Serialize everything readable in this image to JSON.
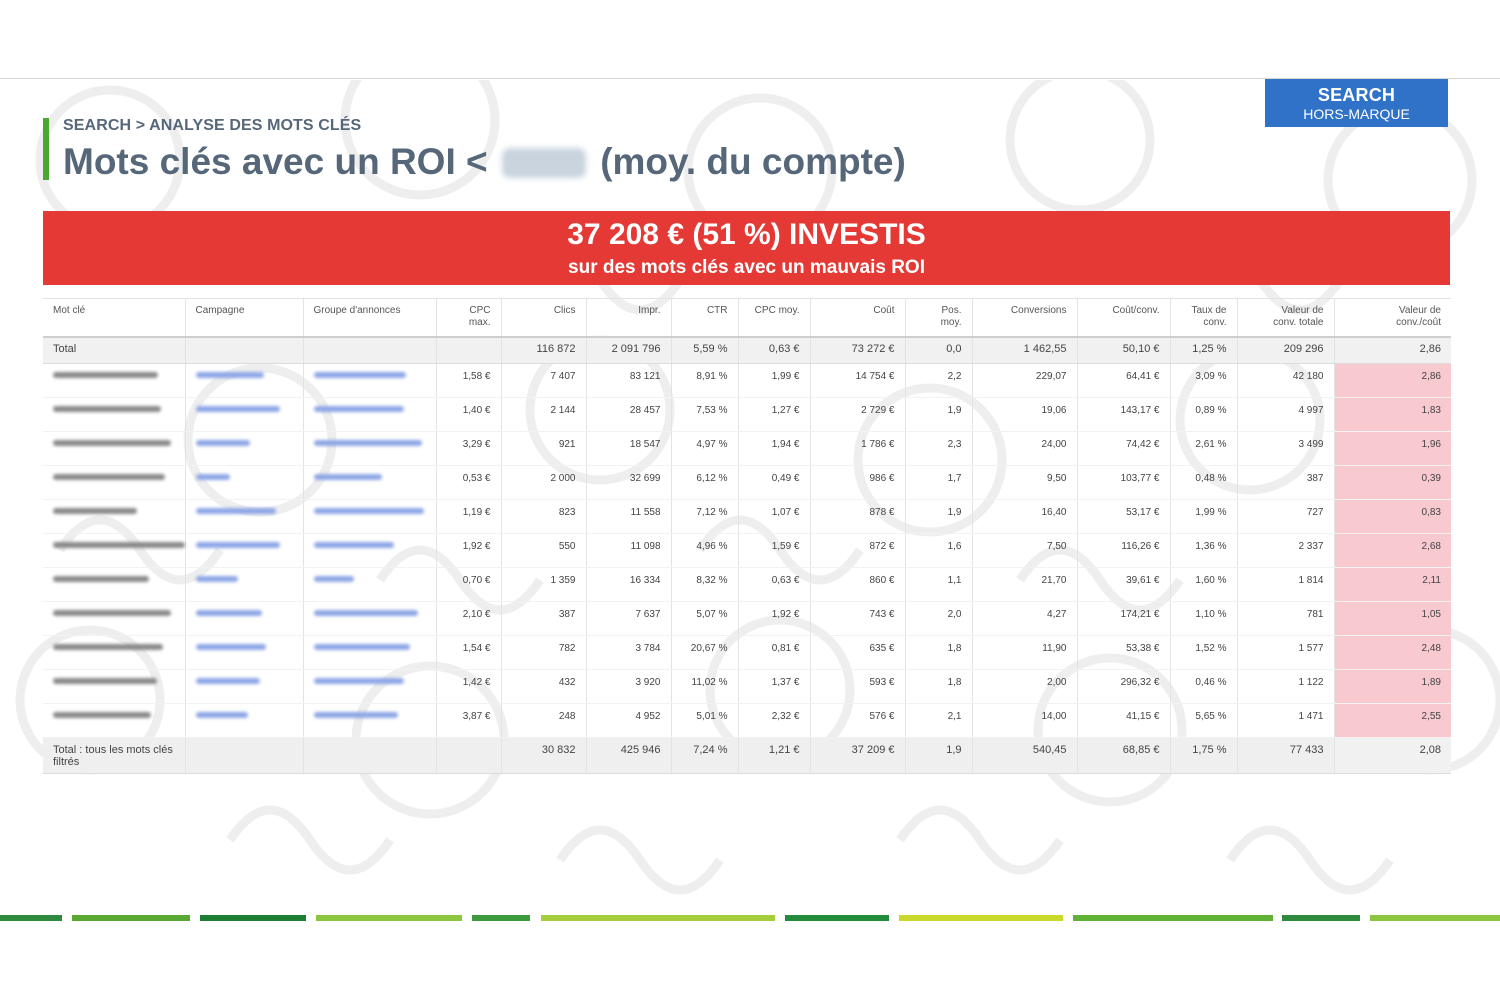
{
  "badge": {
    "line1": "SEARCH",
    "line2": "HORS-MARQUE"
  },
  "header": {
    "breadcrumb": "SEARCH > ANALYSE DES MOTS CLÉS",
    "title_before": "Mots clés avec un ROI <",
    "title_after": "(moy. du compte)"
  },
  "banner": {
    "headline": "37 208 € (51 %) INVESTIS",
    "subline": "sur des mots clés avec un mauvais ROI"
  },
  "table": {
    "columns": [
      "Mot clé",
      "Campagne",
      "Groupe d'annonces",
      "CPC\nmax.",
      "Clics",
      "Impr.",
      "CTR",
      "CPC moy.",
      "Coût",
      "Pos.\nmoy.",
      "Conversions",
      "Coût/conv.",
      "Taux de\nconv.",
      "Valeur de\nconv. totale",
      "Valeur de\nconv./coût"
    ],
    "total": [
      "Total",
      "",
      "",
      "",
      "116 872",
      "2 091 796",
      "5,59 %",
      "0,63 €",
      "73 272 €",
      "0,0",
      "1 462,55",
      "50,10 €",
      "1,25 %",
      "209 296",
      "2,86"
    ],
    "rows": [
      [
        "1,58 €",
        "7 407",
        "83 121",
        "8,91 %",
        "1,99 €",
        "14 754 €",
        "2,2",
        "229,07",
        "64,41 €",
        "3,09 %",
        "42 180",
        "2,86"
      ],
      [
        "1,40 €",
        "2 144",
        "28 457",
        "7,53 %",
        "1,27 €",
        "2 729 €",
        "1,9",
        "19,06",
        "143,17 €",
        "0,89 %",
        "4 997",
        "1,83"
      ],
      [
        "3,29 €",
        "921",
        "18 547",
        "4,97 %",
        "1,94 €",
        "1 786 €",
        "2,3",
        "24,00",
        "74,42 €",
        "2,61 %",
        "3 499",
        "1,96"
      ],
      [
        "0,53 €",
        "2 000",
        "32 699",
        "6,12 %",
        "0,49 €",
        "986 €",
        "1,7",
        "9,50",
        "103,77 €",
        "0,48 %",
        "387",
        "0,39"
      ],
      [
        "1,19 €",
        "823",
        "11 558",
        "7,12 %",
        "1,07 €",
        "878 €",
        "1,9",
        "16,40",
        "53,17 €",
        "1,99 %",
        "727",
        "0,83"
      ],
      [
        "1,92 €",
        "550",
        "11 098",
        "4,96 %",
        "1,59 €",
        "872 €",
        "1,6",
        "7,50",
        "116,26 €",
        "1,36 %",
        "2 337",
        "2,68"
      ],
      [
        "0,70 €",
        "1 359",
        "16 334",
        "8,32 %",
        "0,63 €",
        "860 €",
        "1,1",
        "21,70",
        "39,61 €",
        "1,60 %",
        "1 814",
        "2,11"
      ],
      [
        "2,10 €",
        "387",
        "7 637",
        "5,07 %",
        "1,92 €",
        "743 €",
        "2,0",
        "4,27",
        "174,21 €",
        "1,10 %",
        "781",
        "1,05"
      ],
      [
        "1,54 €",
        "782",
        "3 784",
        "20,67 %",
        "0,81 €",
        "635 €",
        "1,8",
        "11,90",
        "53,38 €",
        "1,52 %",
        "1 577",
        "2,48"
      ],
      [
        "1,42 €",
        "432",
        "3 920",
        "11,02 %",
        "1,37 €",
        "593 €",
        "1,8",
        "2,00",
        "296,32 €",
        "0,46 %",
        "1 122",
        "1,89"
      ],
      [
        "3,87 €",
        "248",
        "4 952",
        "5,01 %",
        "2,32 €",
        "576 €",
        "2,1",
        "14,00",
        "41,15 €",
        "5,65 %",
        "1 471",
        "2,55"
      ]
    ],
    "grand_total": [
      "Total : tous les mots clés filtrés",
      "",
      "",
      "",
      "30 832",
      "425 946",
      "7,24 %",
      "1,21 €",
      "37 209 €",
      "1,9",
      "540,45",
      "68,85 €",
      "1,75 %",
      "77 433",
      "2,08"
    ]
  },
  "colors": {
    "accent_red": "#e53935",
    "badge_blue": "#2f72c8",
    "title_green": "#4aa832",
    "highlight_pink": "#f8c9cf",
    "title_gray": "#56677a"
  }
}
